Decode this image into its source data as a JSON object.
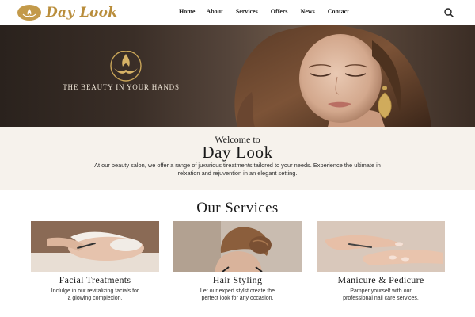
{
  "header": {
    "logo_text": "Day Look",
    "nav": [
      "Home",
      "About",
      "Services",
      "Offers",
      "News",
      "Contact"
    ]
  },
  "hero": {
    "tagline": "THE BEAUTY IN YOUR HANDS"
  },
  "welcome": {
    "small": "Welcome to",
    "big": "Day Look",
    "text": "At our beauty salon, we offer a range of juxurious tireatments tailored to your needs. Experience the ultimate in relxation and rejuvention in an elegant setting."
  },
  "services": {
    "title": "Our Services",
    "items": [
      {
        "title": "Facial Treatments",
        "text": "Inclulge in our revitalizing facials for a glowing complexion."
      },
      {
        "title": "Hair Styling",
        "text": "Let our expert stylst create the perfect look for any occasion."
      },
      {
        "title": "Manicure & Pedicure",
        "text": "Pamper yourself with our professional nail care services."
      }
    ]
  },
  "colors": {
    "brand_gold": "#b98d3b",
    "hero_dark": "#2a221d",
    "welcome_bg": "#f6f2ec"
  }
}
